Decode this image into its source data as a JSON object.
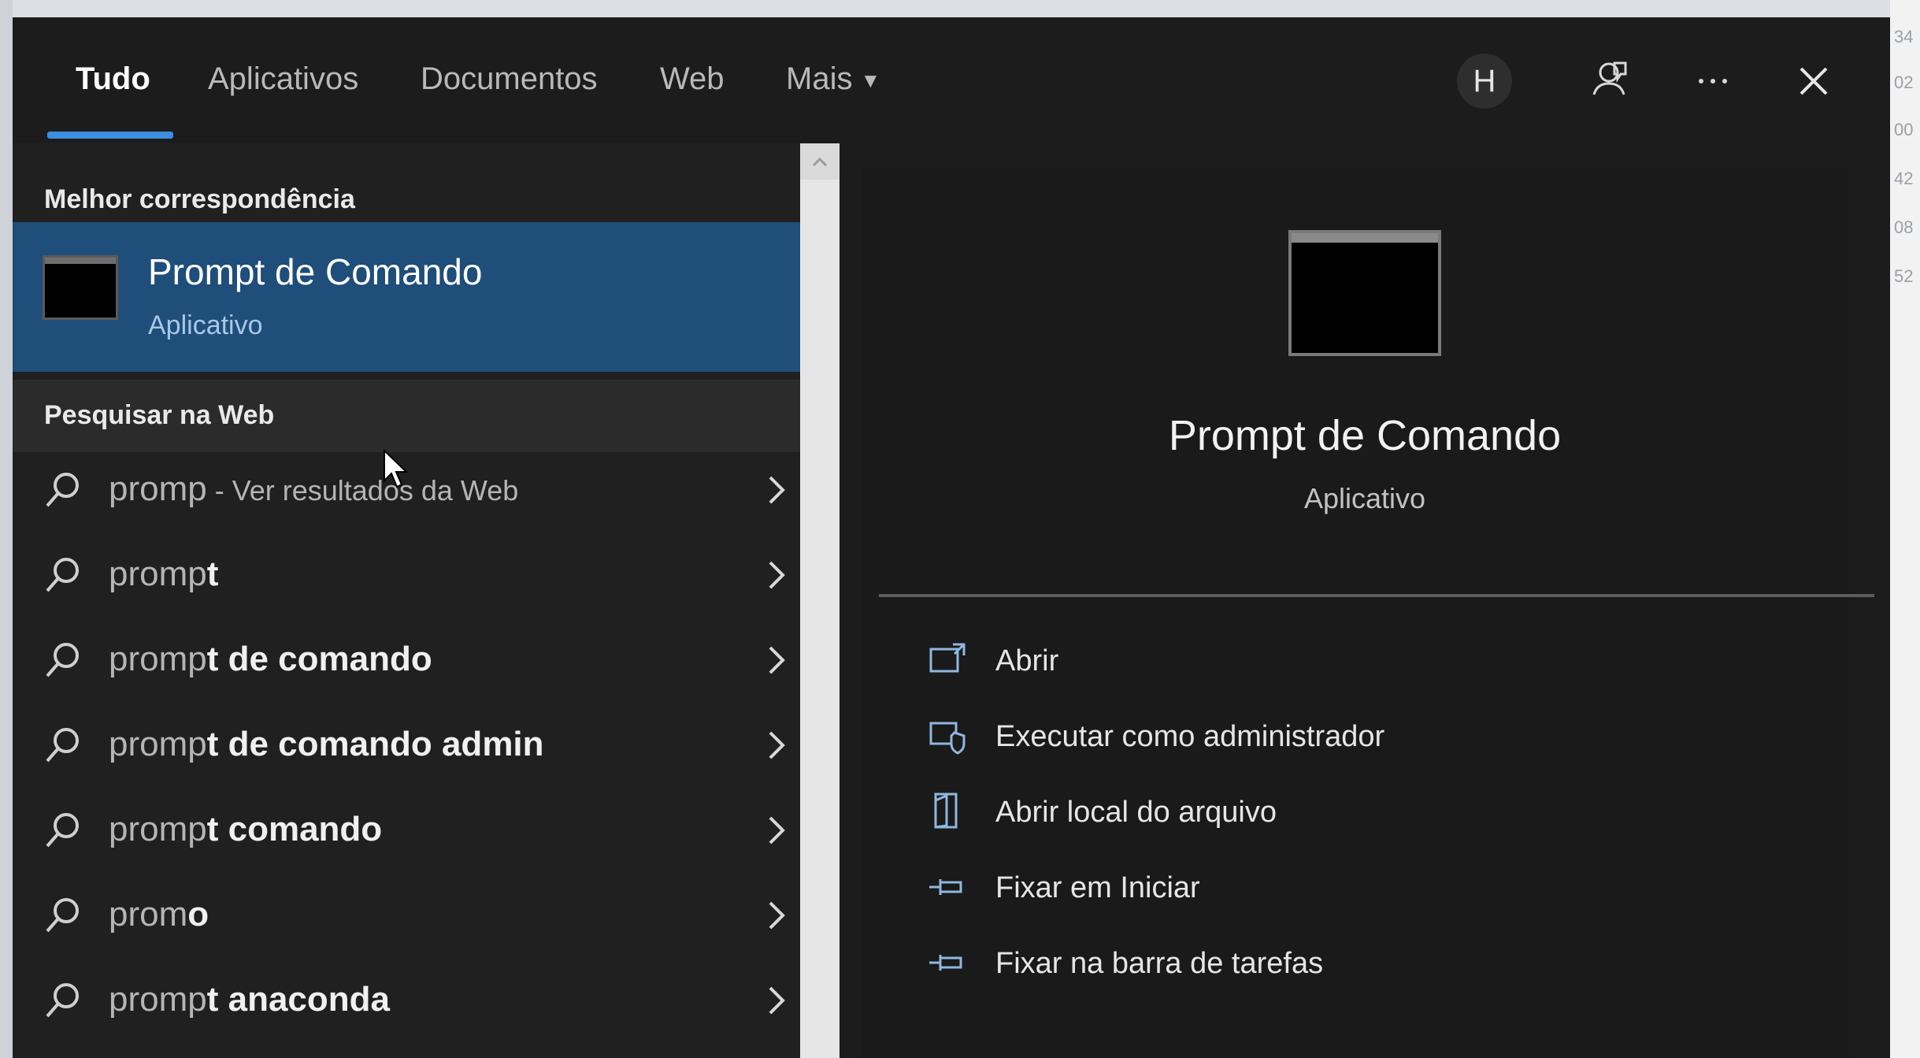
{
  "edge_numbers": [
    "34",
    "02",
    "00",
    "42",
    "08",
    "52"
  ],
  "tabs": [
    {
      "label": "Tudo",
      "active": true
    },
    {
      "label": "Aplicativos",
      "active": false
    },
    {
      "label": "Documentos",
      "active": false
    },
    {
      "label": "Web",
      "active": false
    },
    {
      "label": "Mais",
      "active": false,
      "has_dropdown": true
    }
  ],
  "header": {
    "avatar_initial": "H",
    "icons": [
      "feedback-icon",
      "more-options-icon",
      "close-icon"
    ],
    "more_label": "···"
  },
  "best_match": {
    "section_label": "Melhor correspondência",
    "title": "Prompt de Comando",
    "subtitle": "Aplicativo",
    "icon": "command-prompt-icon"
  },
  "web_search": {
    "section_label": "Pesquisar na Web",
    "results": [
      {
        "typed": "promp",
        "completion": "",
        "suffix": " - Ver resultados da Web"
      },
      {
        "typed": "promp",
        "completion": "t",
        "suffix": ""
      },
      {
        "typed": "promp",
        "completion": "t de comando",
        "suffix": ""
      },
      {
        "typed": "promp",
        "completion": "t de comando admin",
        "suffix": ""
      },
      {
        "typed": "promp",
        "completion": "t comando",
        "suffix": ""
      },
      {
        "typed": "prom",
        "completion": "o",
        "suffix": ""
      },
      {
        "typed": "promp",
        "completion": "t anaconda",
        "suffix": ""
      }
    ]
  },
  "preview": {
    "title": "Prompt de Comando",
    "subtitle": "Aplicativo",
    "icon": "command-prompt-icon",
    "actions": [
      {
        "label": "Abrir",
        "icon": "open-icon"
      },
      {
        "label": "Executar como administrador",
        "icon": "run-as-admin-icon"
      },
      {
        "label": "Abrir local do arquivo",
        "icon": "file-location-icon"
      },
      {
        "label": "Fixar em Iniciar",
        "icon": "pin-start-icon"
      },
      {
        "label": "Fixar na barra de tarefas",
        "icon": "pin-taskbar-icon"
      }
    ]
  },
  "colors": {
    "accent": "#3d8ee0",
    "selection": "#1e4e79",
    "panel": "#202020"
  }
}
